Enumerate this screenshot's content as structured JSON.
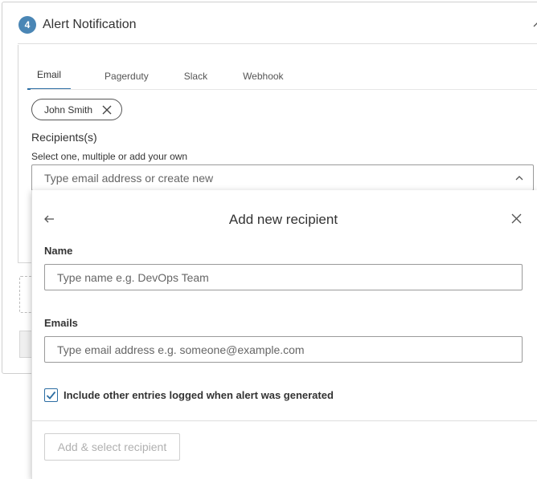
{
  "step": {
    "number": "4",
    "title": "Alert Notification"
  },
  "tabs": [
    {
      "label": "Email",
      "active": true
    },
    {
      "label": "Pagerduty",
      "active": false
    },
    {
      "label": "Slack",
      "active": false
    },
    {
      "label": "Webhook",
      "active": false
    }
  ],
  "selected_recipients": [
    {
      "label": "John Smith"
    }
  ],
  "recipients": {
    "label": "Recipients(s)",
    "help": "Select one, multiple or add your own",
    "placeholder": "Type email address or create new",
    "value": ""
  },
  "add_recipient": {
    "title": "Add new recipient",
    "name_label": "Name",
    "name_placeholder": "Type name e.g. DevOps Team",
    "name_value": "",
    "emails_label": "Emails",
    "emails_placeholder": "Type email address e.g. someone@example.com",
    "emails_value": "",
    "include_label": "Include other entries logged when alert was generated",
    "include_checked": true,
    "submit_label": "Add & select recipient",
    "submit_disabled": true
  },
  "icons": {
    "collapse": "chevron-up-icon",
    "chip_remove": "close-icon",
    "dropdown": "chevron-up-icon",
    "back": "arrow-left-icon",
    "close": "close-icon",
    "checkbox": "checkmark-icon"
  },
  "colors": {
    "accent": "#2d6ea3",
    "step_badge": "#4a86b5",
    "disabled_text": "#b0b0b0"
  }
}
